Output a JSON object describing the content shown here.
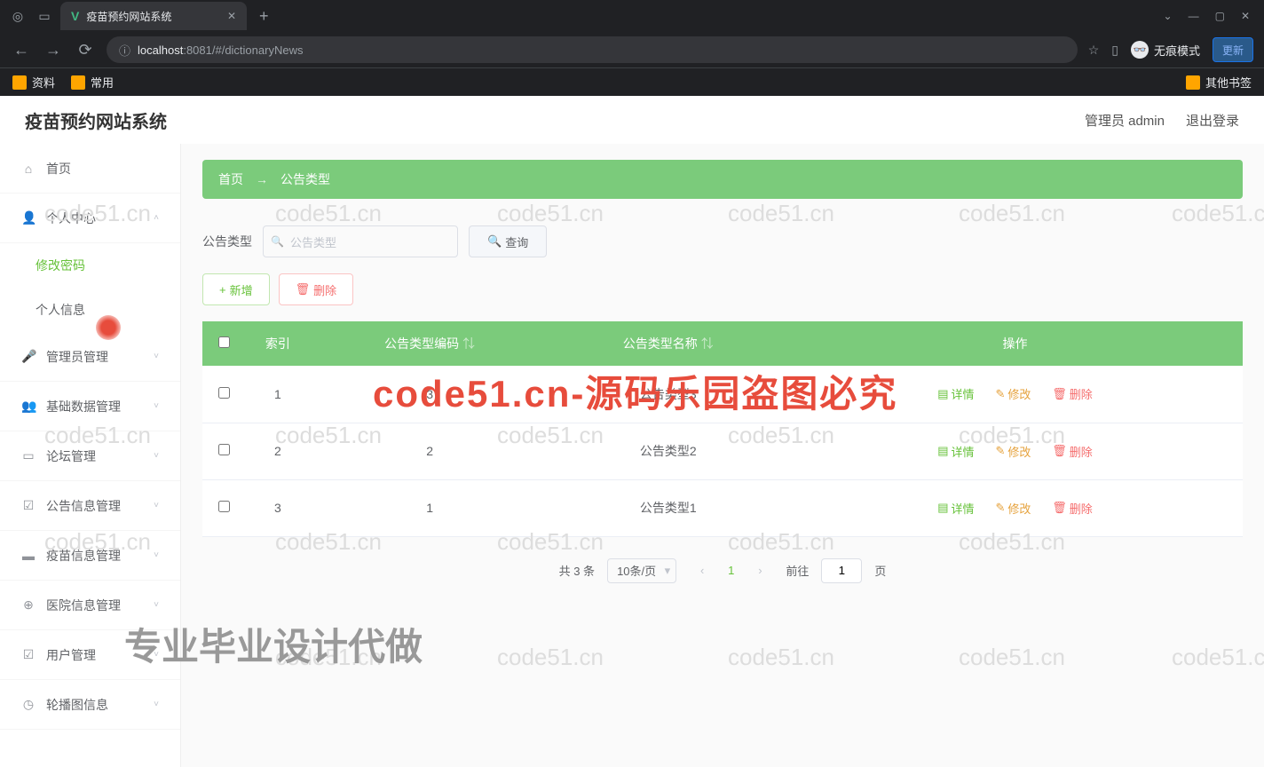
{
  "browser": {
    "tab_title": "疫苗预约网站系统",
    "url_info_icon": "ⓘ",
    "url_host": "localhost",
    "url_rest": ":8081/#/dictionaryNews",
    "incognito_label": "无痕模式",
    "update_label": "更新",
    "bookmarks": [
      "资料",
      "常用"
    ],
    "bookmark_right": "其他书签"
  },
  "header": {
    "title": "疫苗预约网站系统",
    "user": "管理员 admin",
    "logout": "退出登录"
  },
  "sidebar": {
    "items": [
      {
        "icon": "⌂",
        "label": "首页",
        "arrow": false
      },
      {
        "icon": "👤",
        "label": "个人中心",
        "arrow": true,
        "expanded": true,
        "sub": [
          {
            "label": "修改密码",
            "active": true
          },
          {
            "label": "个人信息",
            "active": false
          }
        ]
      },
      {
        "icon": "🎤",
        "label": "管理员管理",
        "arrow": true
      },
      {
        "icon": "👥",
        "label": "基础数据管理",
        "arrow": true
      },
      {
        "icon": "▭",
        "label": "论坛管理",
        "arrow": true
      },
      {
        "icon": "☑",
        "label": "公告信息管理",
        "arrow": true
      },
      {
        "icon": "▬",
        "label": "疫苗信息管理",
        "arrow": true
      },
      {
        "icon": "⊕",
        "label": "医院信息管理",
        "arrow": true
      },
      {
        "icon": "☑",
        "label": "用户管理",
        "arrow": true
      },
      {
        "icon": "◷",
        "label": "轮播图信息",
        "arrow": true
      }
    ]
  },
  "breadcrumb": {
    "home": "首页",
    "sep": "→",
    "current": "公告类型"
  },
  "search": {
    "label": "公告类型",
    "placeholder": "公告类型",
    "button": "查询"
  },
  "actions": {
    "add": "新增",
    "delete": "删除"
  },
  "table": {
    "headers": {
      "index": "索引",
      "code": "公告类型编码",
      "name": "公告类型名称",
      "ops": "操作"
    },
    "rows": [
      {
        "idx": "1",
        "code": "3",
        "name": "公告类型3"
      },
      {
        "idx": "2",
        "code": "2",
        "name": "公告类型2"
      },
      {
        "idx": "3",
        "code": "1",
        "name": "公告类型1"
      }
    ],
    "ops": {
      "detail": "详情",
      "edit": "修改",
      "del": "删除"
    }
  },
  "pagination": {
    "total": "共 3 条",
    "per_page": "10条/页",
    "current": "1",
    "goto_prefix": "前往",
    "goto_value": "1",
    "goto_suffix": "页"
  },
  "watermarks": {
    "site": "code51.cn",
    "red": "code51.cn-源码乐园盗图必究",
    "gray": "专业毕业设计代做"
  }
}
